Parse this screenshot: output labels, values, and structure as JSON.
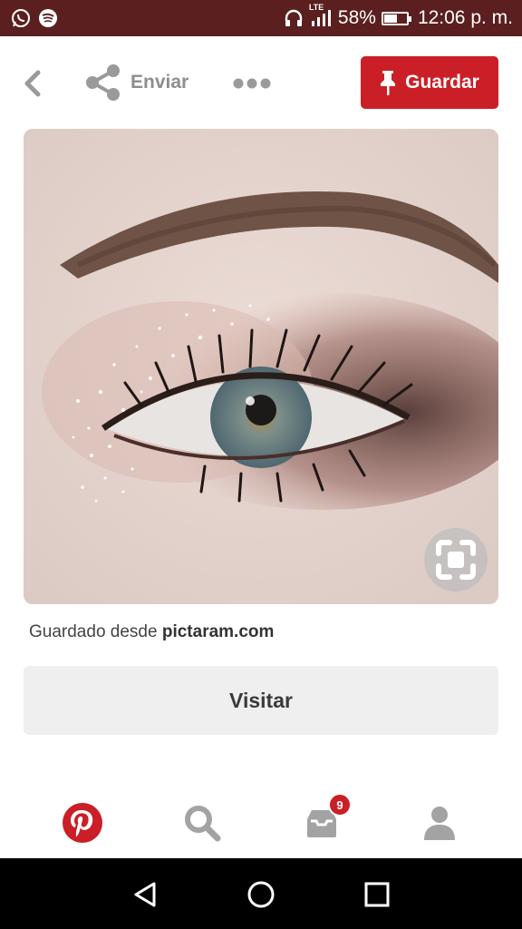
{
  "status_bar": {
    "network_label": "LTE",
    "battery_percent": "58%",
    "battery_level": 0.58,
    "time": "12:06 p. m.",
    "icons": [
      "whatsapp-icon",
      "spotify-icon",
      "headset-icon",
      "signal-icon",
      "battery-icon"
    ]
  },
  "action_bar": {
    "back_icon": "chevron-left-icon",
    "share_label": "Enviar",
    "more_icon": "more-dots-icon",
    "save_label": "Guardar"
  },
  "pin": {
    "image_description_icon": "eye-makeup-photo",
    "lens_icon": "visual-search-icon"
  },
  "source": {
    "prefix": "Guardado desde ",
    "domain": "pictaram.com"
  },
  "visit_button": {
    "label": "Visitar"
  },
  "tab_bar": {
    "tabs": [
      {
        "name": "home",
        "icon": "pinterest-logo-icon"
      },
      {
        "name": "search",
        "icon": "search-icon"
      },
      {
        "name": "inbox",
        "icon": "inbox-icon",
        "badge": "9"
      },
      {
        "name": "profile",
        "icon": "user-icon"
      }
    ]
  },
  "colors": {
    "status_bar": "#5b1f1f",
    "accent": "#cb1f27",
    "visit_bg": "#efefef"
  }
}
